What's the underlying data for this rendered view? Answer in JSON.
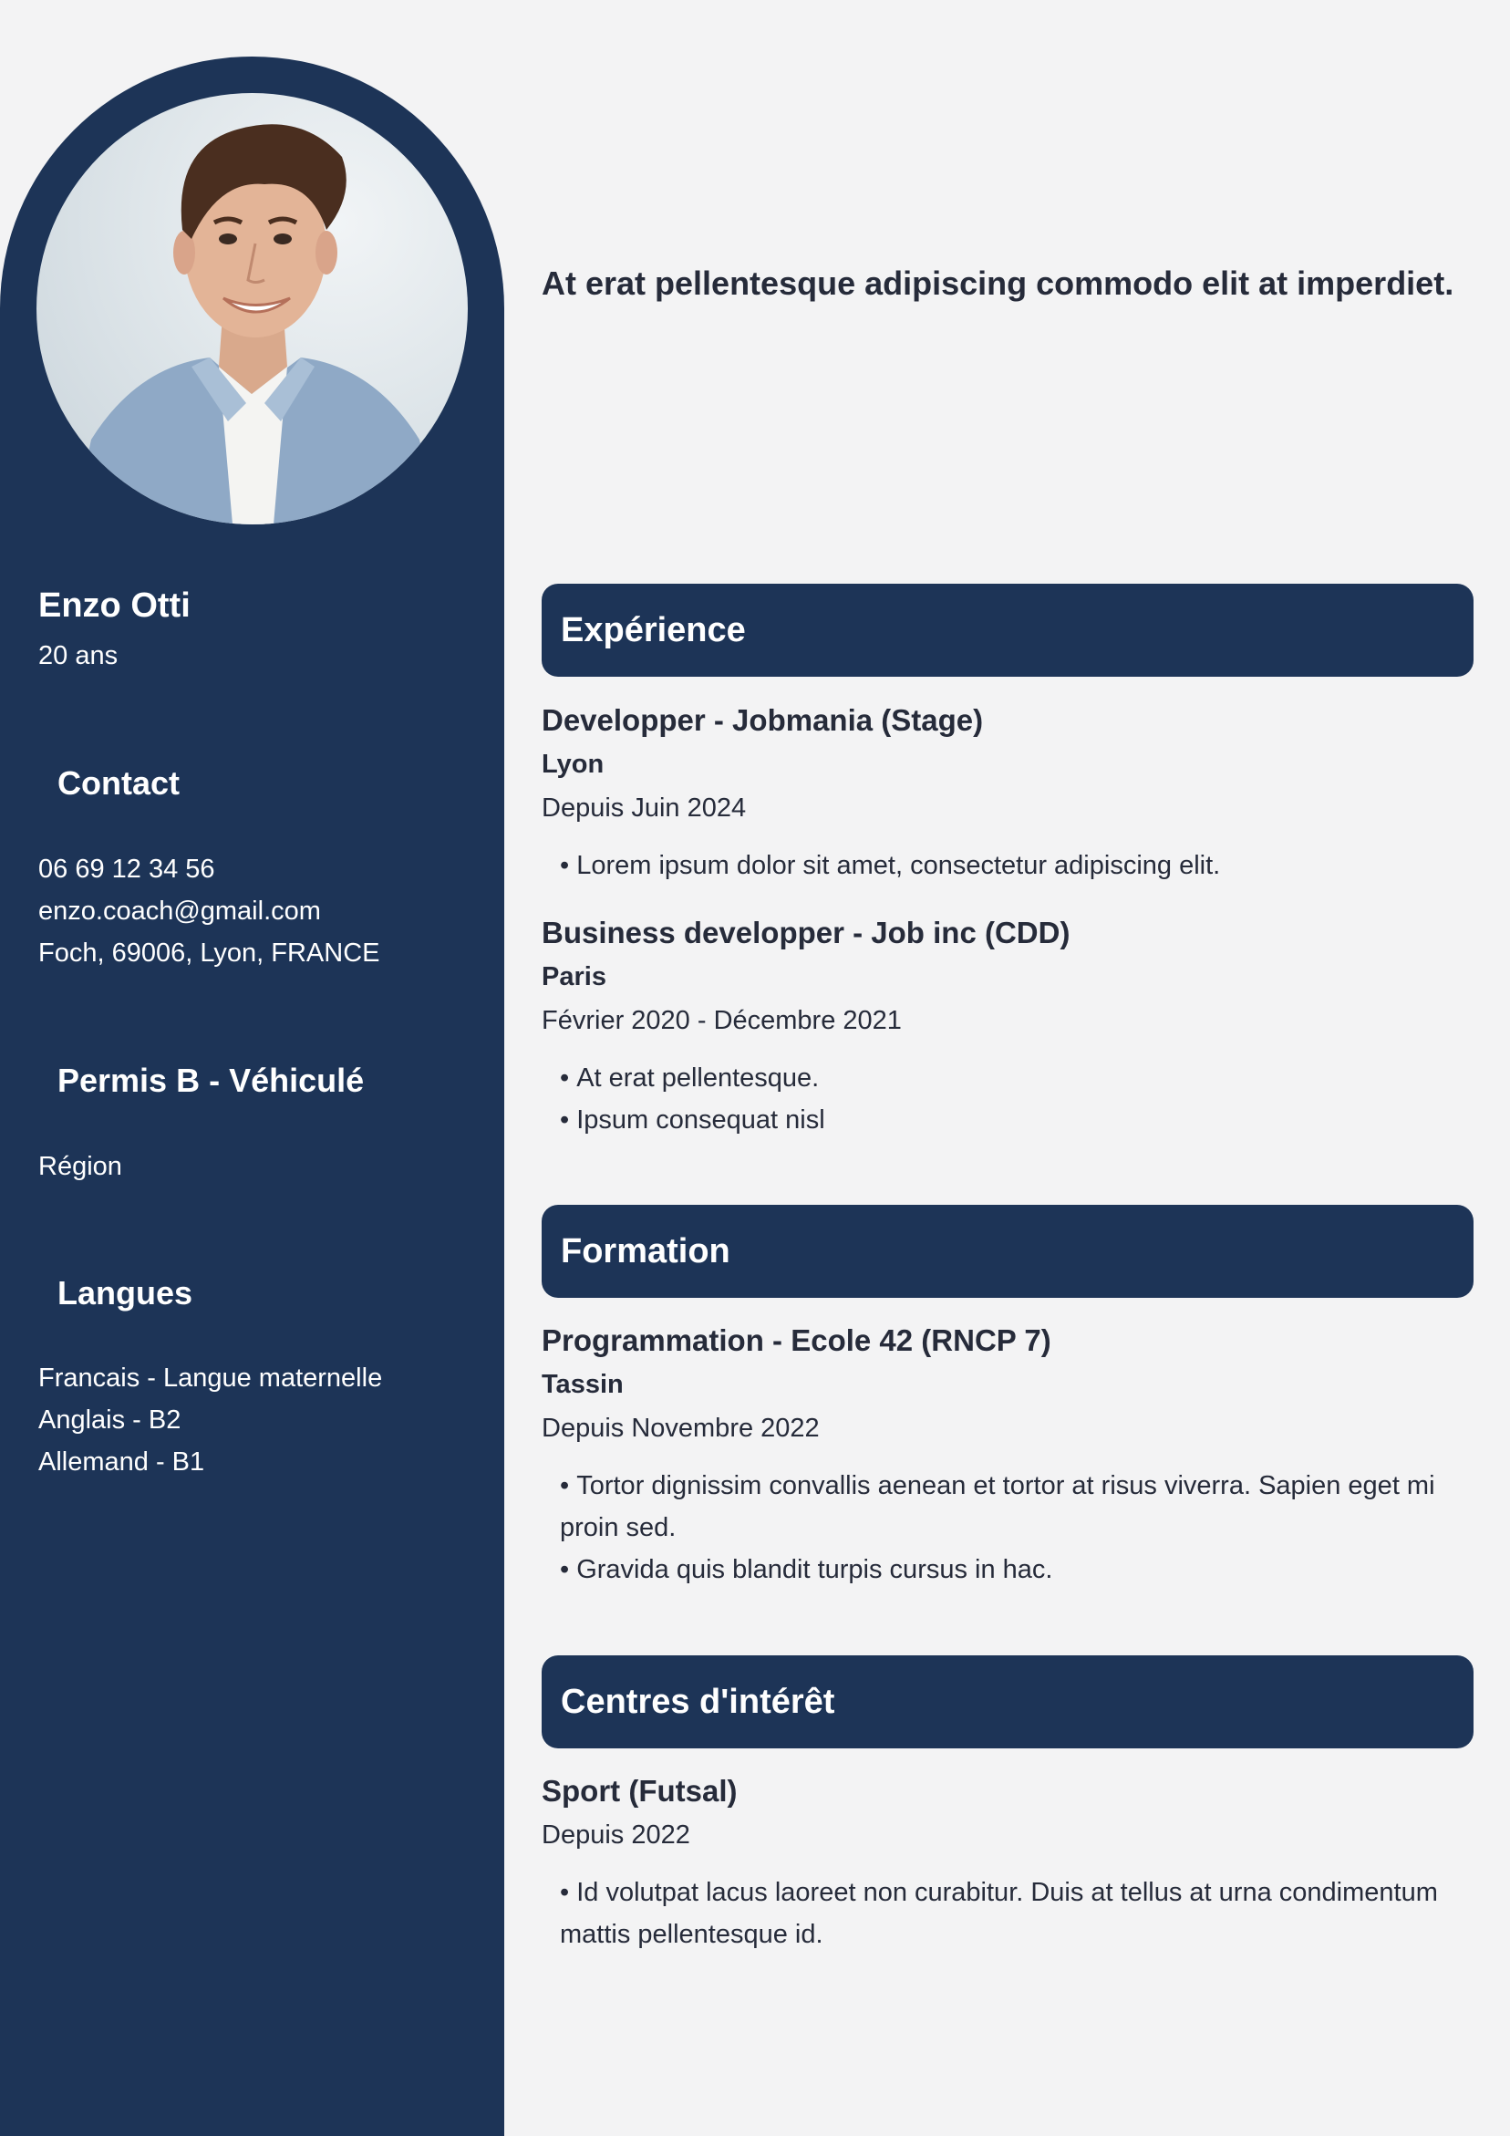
{
  "summary": "At erat pellentesque adipiscing commodo elit at imperdiet.",
  "profile": {
    "name": "Enzo Otti",
    "age": "20 ans"
  },
  "contact": {
    "heading": "Contact",
    "lines": [
      "06 69 12 34 56",
      "enzo.coach@gmail.com",
      "Foch, 69006, Lyon, FRANCE"
    ]
  },
  "permis": {
    "heading": "Permis B - Véhiculé",
    "lines": [
      "Région"
    ]
  },
  "langues": {
    "heading": "Langues",
    "lines": [
      "Francais - Langue maternelle",
      "Anglais - B2",
      "Allemand - B1"
    ]
  },
  "experience": {
    "heading": "Expérience",
    "entries": [
      {
        "title": "Developper - Jobmania (Stage)",
        "place": "Lyon",
        "date": "Depuis Juin 2024",
        "bullets": [
          "Lorem ipsum dolor sit amet, consectetur adipiscing elit."
        ]
      },
      {
        "title": "Business developper - Job inc (CDD)",
        "place": "Paris",
        "date": "Février 2020 - Décembre 2021",
        "bullets": [
          "At erat pellentesque.",
          "Ipsum consequat nisl"
        ]
      }
    ]
  },
  "formation": {
    "heading": "Formation",
    "entries": [
      {
        "title": "Programmation - Ecole 42 (RNCP 7)",
        "place": "Tassin",
        "date": "Depuis Novembre 2022",
        "bullets": [
          "Tortor dignissim convallis aenean et tortor at risus viverra. Sapien eget mi proin sed.",
          "Gravida quis blandit turpis cursus in hac."
        ]
      }
    ]
  },
  "interets": {
    "heading": "Centres d'intérêt",
    "entries": [
      {
        "title": "Sport (Futsal)",
        "date": "Depuis 2022",
        "bullets": [
          "Id volutpat lacus laoreet non curabitur. Duis at tellus at urna condimentum mattis pellentesque id."
        ]
      }
    ]
  },
  "colors": {
    "navy": "#1d3457",
    "page": "#f3f3f4",
    "text": "#262b3a"
  }
}
